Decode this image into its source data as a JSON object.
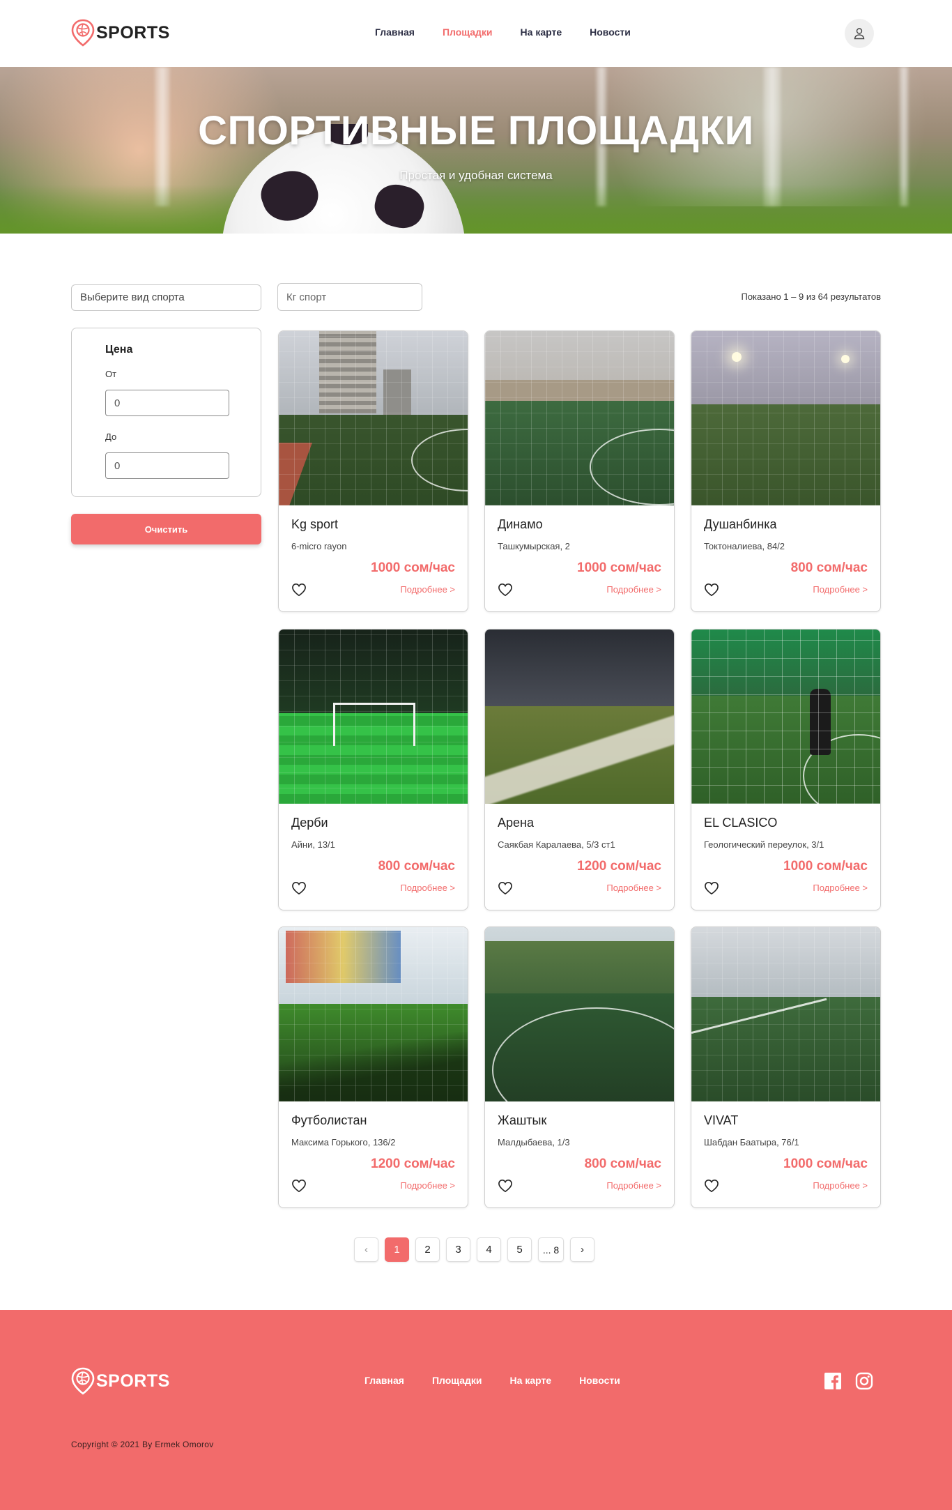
{
  "brand": {
    "name": "SPORTS",
    "accent": "#f26b6b"
  },
  "nav": {
    "items": [
      {
        "label": "Главная",
        "active": false
      },
      {
        "label": "Площадки",
        "active": true
      },
      {
        "label": "На карте",
        "active": false
      },
      {
        "label": "Новости",
        "active": false
      }
    ],
    "user_icon": "user-icon"
  },
  "hero": {
    "title": "СПОРТИВНЫЕ ПЛОЩАДКИ",
    "subtitle": "Простая и удобная система"
  },
  "filters": {
    "sport_select": "Выберите вид спорта",
    "search_placeholder": "Кг спорт",
    "results": "Показано 1 – 9 из 64 результатов",
    "price": {
      "title": "Цена",
      "from_label": "От",
      "from_value": "0",
      "to_label": "До",
      "to_value": "0"
    },
    "clear_label": "Очистить"
  },
  "cards": [
    {
      "name": "Kg sport",
      "address": "6-micro rayon",
      "price": "1000 сом/час",
      "more": "Подробнее >"
    },
    {
      "name": "Динамо",
      "address": "Ташкумырская, 2",
      "price": "1000 сом/час",
      "more": "Подробнее >"
    },
    {
      "name": "Душанбинка",
      "address": "Токтоналиева, 84/2",
      "price": "800 сом/час",
      "more": "Подробнее >"
    },
    {
      "name": "Дерби",
      "address": "Айни, 13/1",
      "price": "800 сом/час",
      "more": "Подробнее >"
    },
    {
      "name": "Арена",
      "address": "Саякбая Каралаева, 5/3 ст1",
      "price": "1200 сом/час",
      "more": "Подробнее >"
    },
    {
      "name": "EL CLASICO",
      "address": "Геологический переулок, 3/1",
      "price": "1000 сом/час",
      "more": "Подробнее >"
    },
    {
      "name": "Футболистан",
      "address": "Максима Горького, 136/2",
      "price": "1200 сом/час",
      "more": "Подробнее >"
    },
    {
      "name": "Жаштык",
      "address": "Малдыбаева, 1/3",
      "price": "800 сом/час",
      "more": "Подробнее >"
    },
    {
      "name": "VIVAT",
      "address": "Шабдан Баатыра, 76/1",
      "price": "1000 сом/час",
      "more": "Подробнее >"
    }
  ],
  "pagination": {
    "prev": "‹",
    "pages": [
      "1",
      "2",
      "3",
      "4",
      "5",
      "... 8"
    ],
    "current": "1",
    "next": "›"
  },
  "footer": {
    "nav": [
      "Главная",
      "Площадки",
      "На карте",
      "Новости"
    ],
    "social": [
      "facebook-icon",
      "instagram-icon"
    ],
    "copyright": "Copyright © 2021 By Ermek Omorov"
  }
}
